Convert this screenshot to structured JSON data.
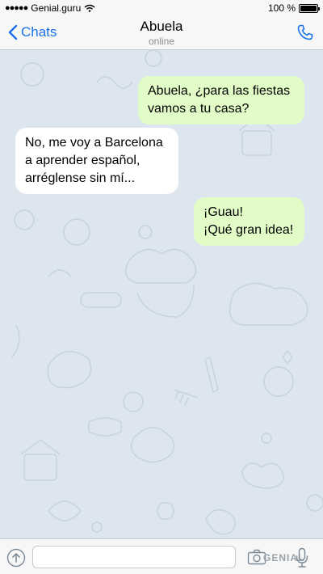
{
  "status_bar": {
    "signal_dots": "●●●●●",
    "carrier": "Genial.guru",
    "time": "",
    "battery": "100 %"
  },
  "nav": {
    "back_label": "Chats",
    "title": "Abuela",
    "subtitle": "online"
  },
  "messages": [
    {
      "direction": "out",
      "lines": [
        "Abuela, ¿para las fiestas",
        "vamos a tu casa?"
      ]
    },
    {
      "direction": "in",
      "lines": [
        "No, me voy a Barcelona",
        "a aprender español,",
        "arréglense sin mí..."
      ]
    },
    {
      "direction": "out",
      "lines": [
        "¡Guau!",
        "¡Qué gran idea!"
      ]
    }
  ],
  "composer": {
    "text_value": "",
    "placeholder": "",
    "watermark": "GENIAL"
  },
  "colors": {
    "accent": "#1a73e8",
    "chat_background": "#dde6ef",
    "outgoing_bubble": "#e1fcc7",
    "incoming_bubble": "#ffffff"
  },
  "icons": [
    "back-chevron-icon",
    "phone-icon",
    "attach-icon",
    "camera-icon",
    "microphone-icon"
  ]
}
